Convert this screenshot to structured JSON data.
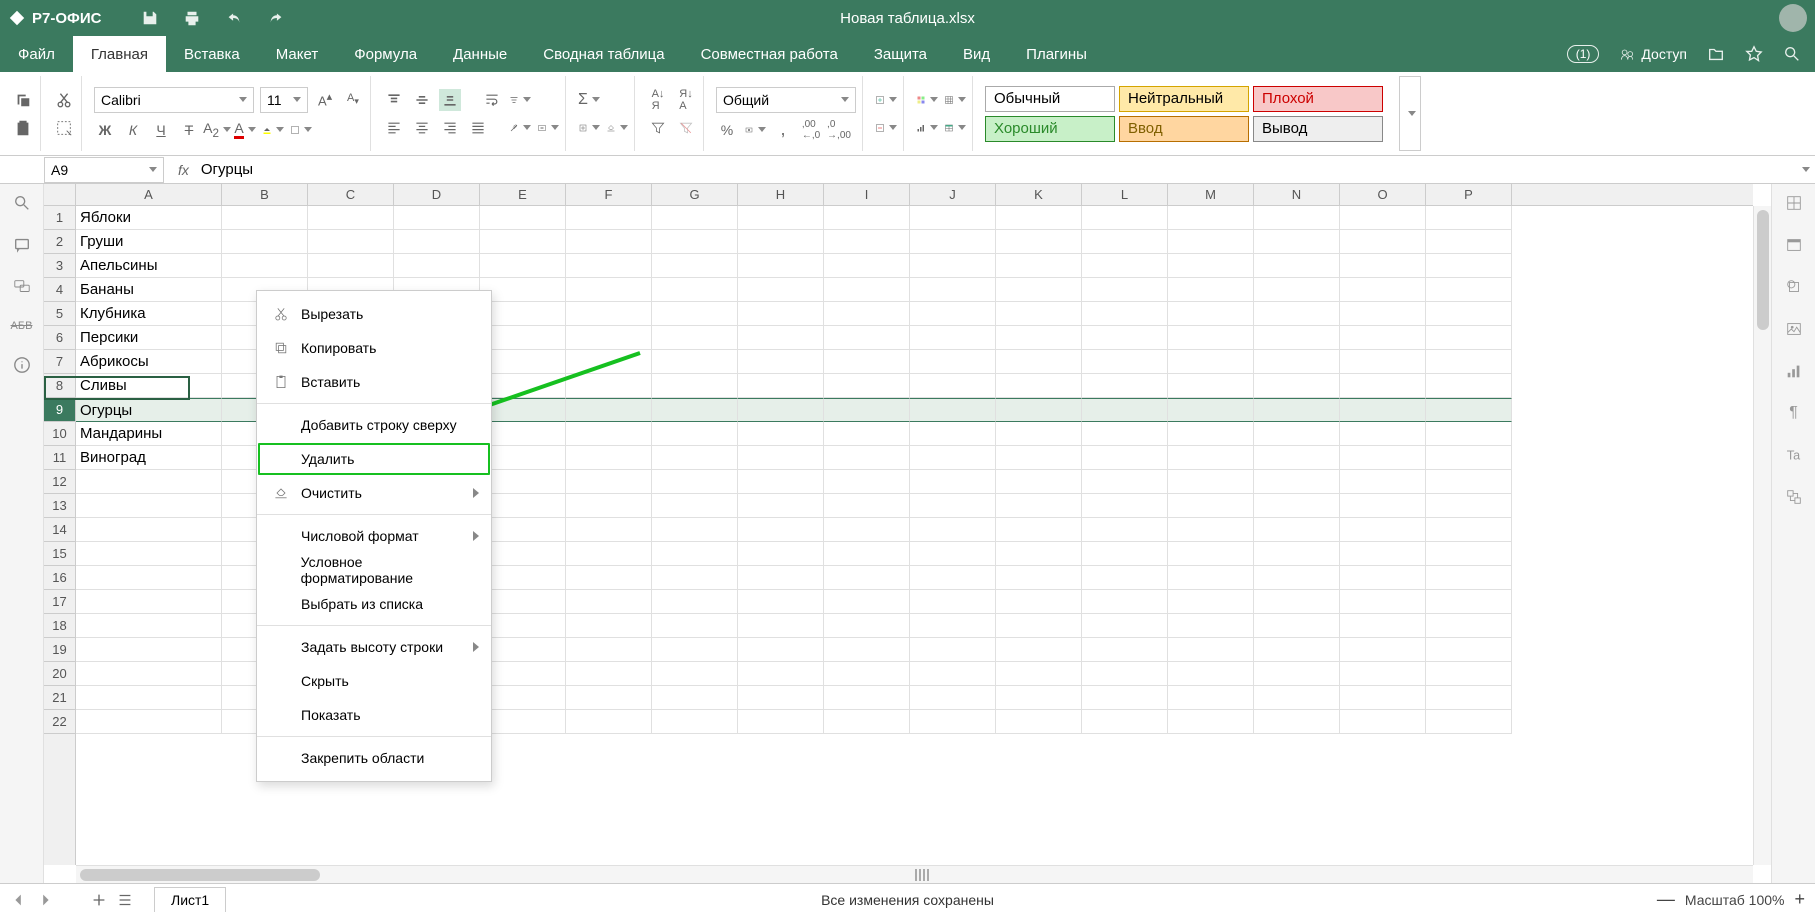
{
  "app": {
    "brand": "Р7-ОФИС",
    "document": "Новая таблица.xlsx"
  },
  "menus": [
    "Файл",
    "Главная",
    "Вставка",
    "Макет",
    "Формула",
    "Данные",
    "Сводная таблица",
    "Совместная работа",
    "Защита",
    "Вид",
    "Плагины"
  ],
  "active_menu_index": 1,
  "share_label": "Доступ",
  "notif_count": "1",
  "toolbar": {
    "font_name": "Calibri",
    "font_size": "11",
    "number_format": "Общий",
    "styles": {
      "normal": "Обычный",
      "neutral": "Нейтральный",
      "bad": "Плохой",
      "good": "Хороший",
      "input": "Ввод",
      "output": "Вывод"
    }
  },
  "name_box": "A9",
  "fx_value": "Огурцы",
  "columns": [
    "A",
    "B",
    "C",
    "D",
    "E",
    "F",
    "G",
    "H",
    "I",
    "J",
    "K",
    "L",
    "M",
    "N",
    "O",
    "P"
  ],
  "row_count": 22,
  "selected_row_index": 8,
  "data_column_A": [
    "Яблоки",
    "Груши",
    "Апельсины",
    "Бананы",
    "Клубника",
    "Персики",
    "Абрикосы",
    "Сливы",
    "Огурцы",
    "Мандарины",
    "Виноград"
  ],
  "context_menu": {
    "cut": "Вырезать",
    "copy": "Копировать",
    "paste": "Вставить",
    "add_row_above": "Добавить строку сверху",
    "delete": "Удалить",
    "clear": "Очистить",
    "number_format": "Числовой формат",
    "cond_format": "Условное форматирование",
    "pick_from_list": "Выбрать из списка",
    "row_height": "Задать высоту строки",
    "hide": "Скрыть",
    "show": "Показать",
    "freeze": "Закрепить области"
  },
  "sheet_tab": "Лист1",
  "status_center": "Все изменения сохранены",
  "zoom_label": "Масштаб 100%"
}
